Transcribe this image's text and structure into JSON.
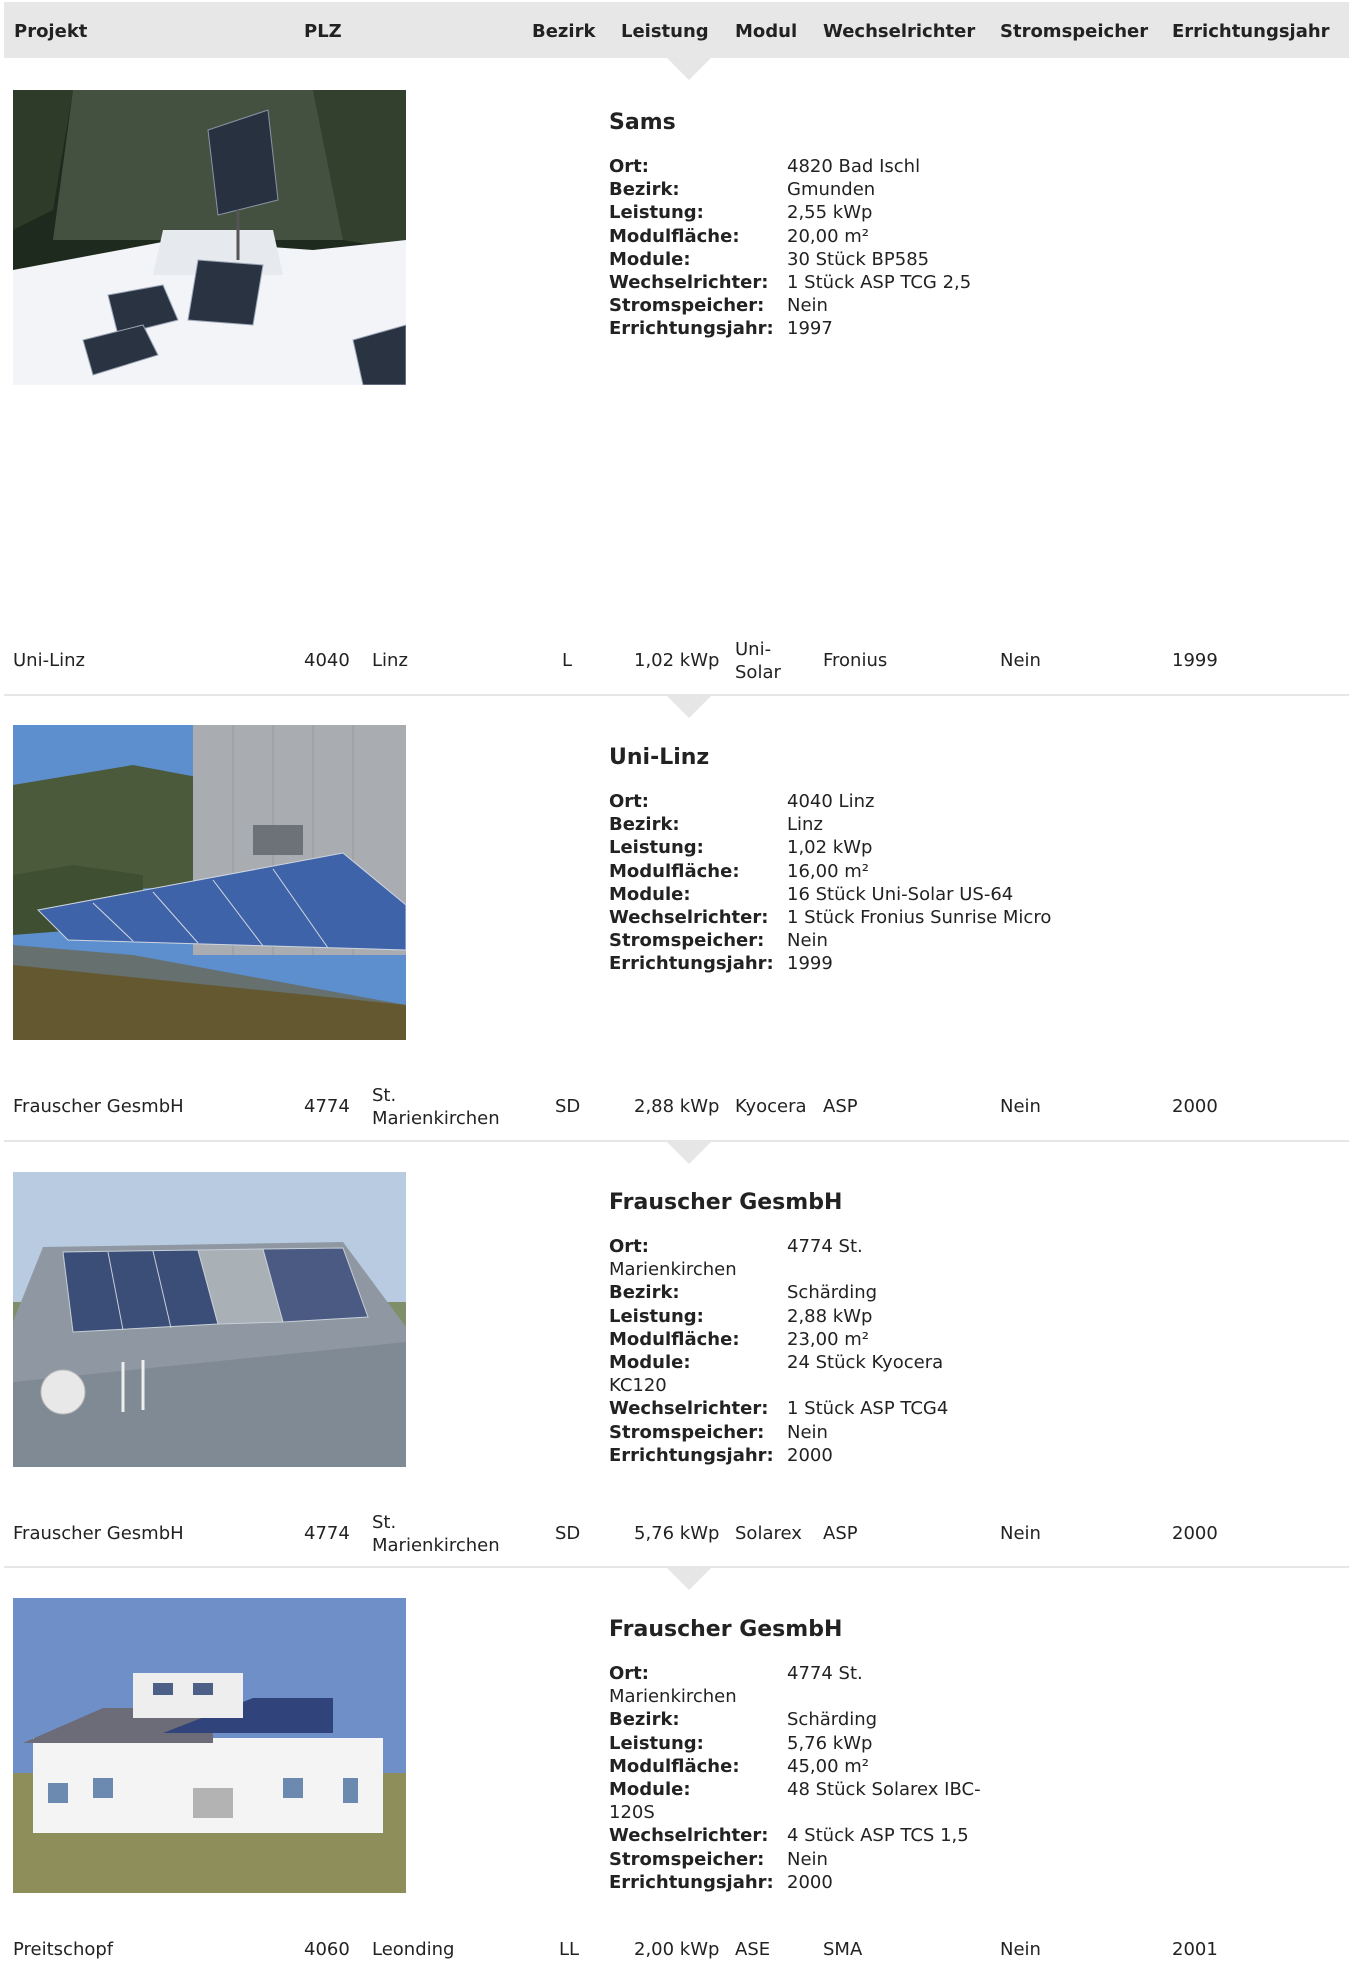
{
  "header": {
    "projekt": "Projekt",
    "plz": "PLZ",
    "bezirk": "Bezirk",
    "leistung": "Leistung",
    "modul": "Modul",
    "wechselrichter": "Wechselrichter",
    "stromspeicher": "Stromspeicher",
    "errichtungsjahr": "Errichtungsjahr"
  },
  "labels": {
    "ort": "Ort:",
    "bezirk": "Bezirk:",
    "leistung": "Leistung:",
    "modulflaeche": "Modulfläche:",
    "module": "Module:",
    "wechselrichter": "Wechselrichter:",
    "stromspeicher": "Stromspeicher:",
    "errichtungsjahr": "Errichtungsjahr:"
  },
  "details": [
    {
      "title": "Sams",
      "plz": "4820",
      "ort": "Bad Ischl",
      "bezirk": "Gmunden",
      "leistung": "2,55 kWp",
      "modulflaeche": "20,00 m²",
      "module": "30 Stück BP585",
      "wechselrichter": "1 Stück ASP TCG 2,5",
      "stromspeicher": "Nein",
      "errichtungsjahr": "1997"
    },
    {
      "title": "Uni-Linz",
      "plz": "4040",
      "ort": "Linz",
      "bezirk": "Linz",
      "leistung": "1,02 kWp",
      "modulflaeche": "16,00 m²",
      "module": "16 Stück Uni-Solar US-64",
      "wechselrichter": "1 Stück Fronius Sunrise Micro",
      "stromspeicher": "Nein",
      "errichtungsjahr": "1999"
    },
    {
      "title": "Frauscher GesmbH",
      "plz": "4774",
      "ort": "St. Marienkirchen",
      "bezirk": "Schärding",
      "leistung": "2,88 kWp",
      "modulflaeche": "23,00 m²",
      "module": "24 Stück Kyocera KC120",
      "wechselrichter": "1 Stück ASP TCG4",
      "stromspeicher": "Nein",
      "errichtungsjahr": "2000"
    },
    {
      "title": "Frauscher GesmbH",
      "plz": "4774",
      "ort": "St. Marienkirchen",
      "bezirk": "Schärding",
      "leistung": "5,76 kWp",
      "modulflaeche": "45,00 m²",
      "module": "48 Stück Solarex IBC-120S",
      "wechselrichter": "4 Stück ASP TCS 1,5",
      "stromspeicher": "Nein",
      "errichtungsjahr": "2000"
    }
  ],
  "rows": [
    {
      "projekt": "Uni-Linz",
      "plz": "4040",
      "ort": "Linz",
      "bezirk": "L",
      "leistung": "1,02 kWp",
      "modul": "Uni-Solar",
      "wechselrichter": "Fronius",
      "stromspeicher": "Nein",
      "errichtungsjahr": "1999"
    },
    {
      "projekt": "Frauscher GesmbH",
      "plz": "4774",
      "ort": "St. Marienkirchen",
      "bezirk": "SD",
      "leistung": "2,88 kWp",
      "modul": "Kyocera",
      "wechselrichter": "ASP",
      "stromspeicher": "Nein",
      "errichtungsjahr": "2000"
    },
    {
      "projekt": "Frauscher GesmbH",
      "plz": "4774",
      "ort": "St. Marienkirchen",
      "bezirk": "SD",
      "leistung": "5,76 kWp",
      "modul": "Solarex",
      "wechselrichter": "ASP",
      "stromspeicher": "Nein",
      "errichtungsjahr": "2000"
    },
    {
      "projekt": "Preitschopf",
      "plz": "4060",
      "ort": "Leonding",
      "bezirk": "LL",
      "leistung": "2,00 kWp",
      "modul": "ASE",
      "wechselrichter": "SMA",
      "stromspeicher": "Nein",
      "errichtungsjahr": "2001"
    }
  ]
}
